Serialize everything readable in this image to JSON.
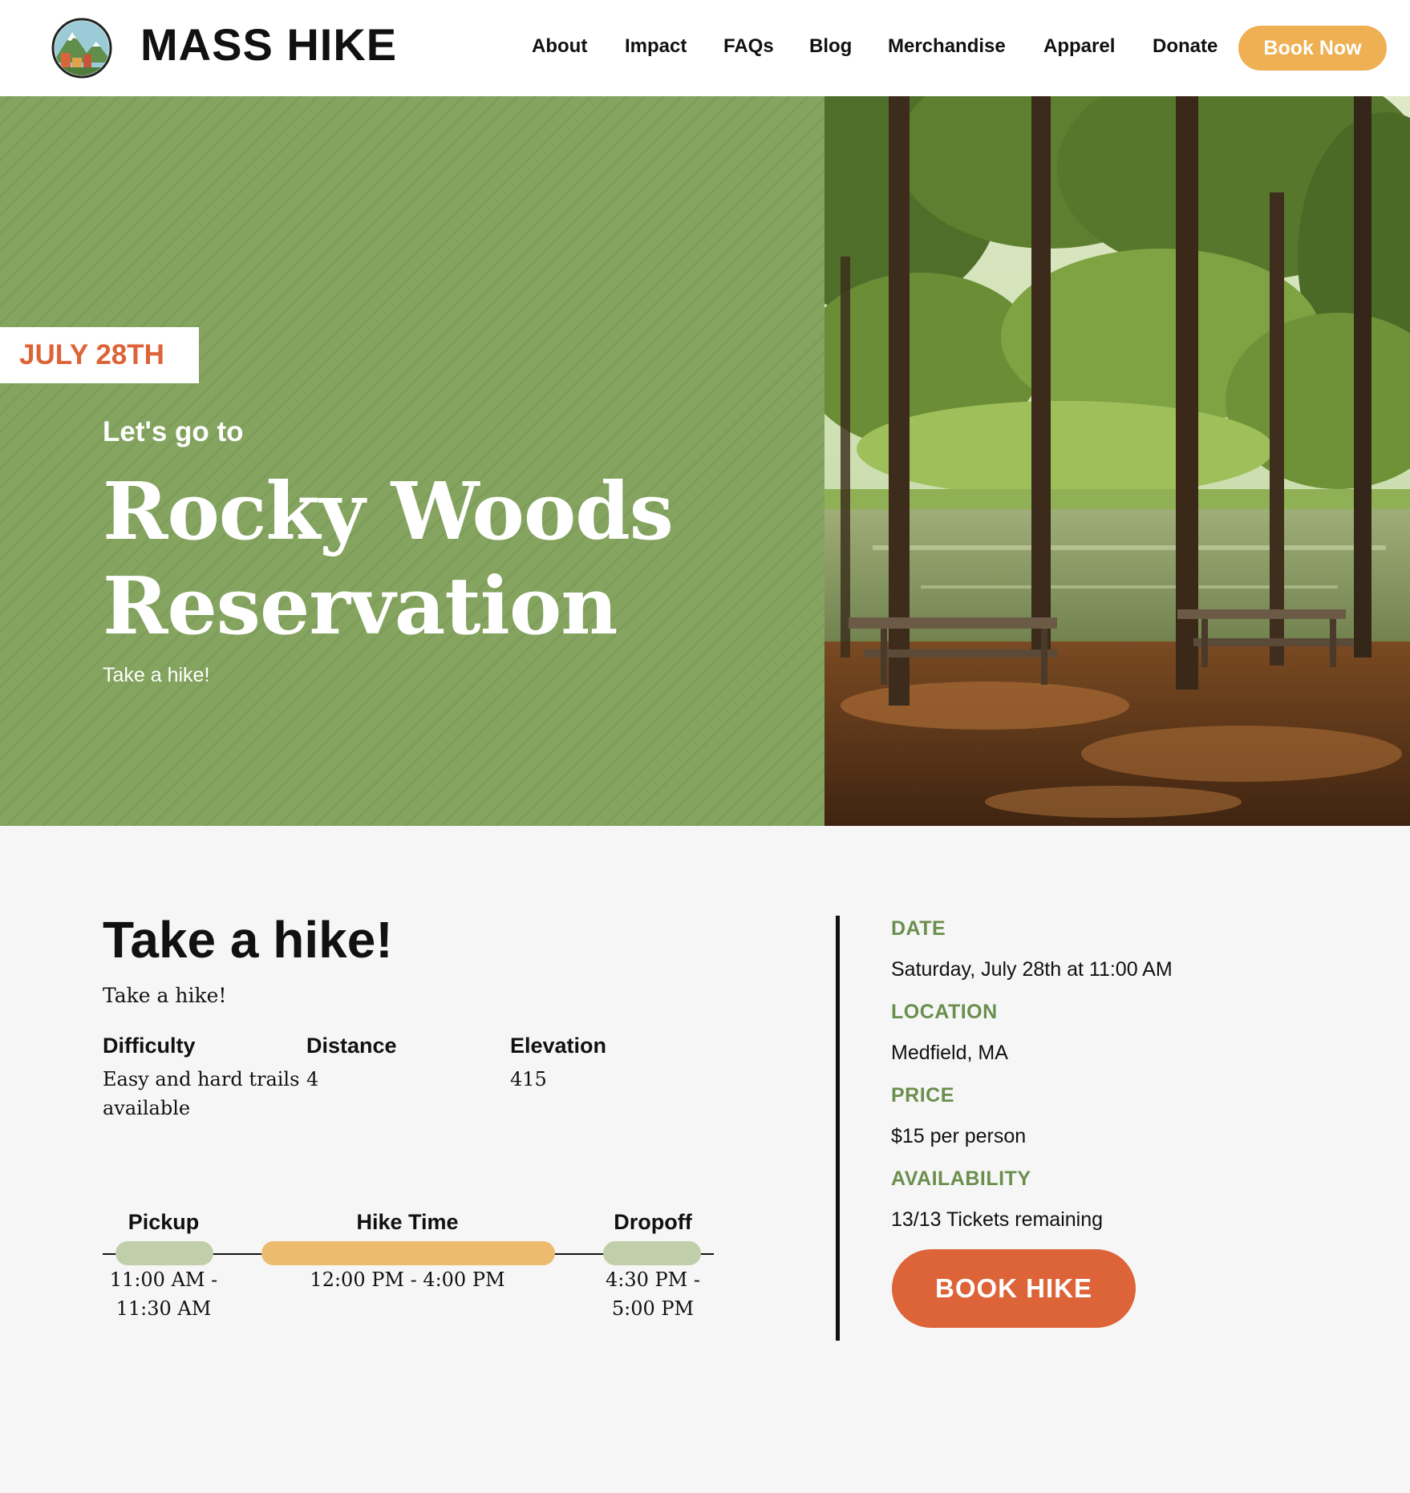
{
  "header": {
    "brand": "MASS HIKE",
    "logo_icon": "mountain-logo-icon",
    "nav": [
      "About",
      "Impact",
      "FAQs",
      "Blog",
      "Merchandise",
      "Apparel",
      "Donate"
    ],
    "cta_label": "Book Now"
  },
  "hero": {
    "date_tag": "JULY 28TH",
    "kicker": "Let's go to",
    "title_line1": "Rocky Woods",
    "title_line2": "Reservation",
    "subtitle": "Take a hike!",
    "photo_icon": "forest-lake-photo"
  },
  "details": {
    "title": "Take a hike!",
    "description": "Take a hike!",
    "stats": [
      {
        "label": "Difficulty",
        "value": "Easy and hard trails available"
      },
      {
        "label": "Distance",
        "value": "4"
      },
      {
        "label": "Elevation",
        "value": "415"
      }
    ],
    "schedule": [
      {
        "label": "Pickup",
        "time": "11:00 AM - 11:30 AM"
      },
      {
        "label": "Hike Time",
        "time": "12:00 PM - 4:00 PM"
      },
      {
        "label": "Dropoff",
        "time": "4:30 PM - 5:00 PM"
      }
    ]
  },
  "info": {
    "date_label": "DATE",
    "date_value": "Saturday, July 28th at 11:00 AM",
    "location_label": "LOCATION",
    "location_value": "Medfield, MA",
    "price_label": "PRICE",
    "price_value": "$15 per person",
    "availability_label": "AVAILABILITY",
    "availability_value": "13/13 Tickets remaining",
    "book_label": "BOOK HIKE"
  },
  "colors": {
    "hero_green": "#84a45f",
    "accent_orange": "#dd6439",
    "cta_yellow": "#eeb052",
    "label_green": "#6a8f4d",
    "pickup_pill": "#c0cfaa",
    "hike_pill": "#ecbb6e"
  }
}
